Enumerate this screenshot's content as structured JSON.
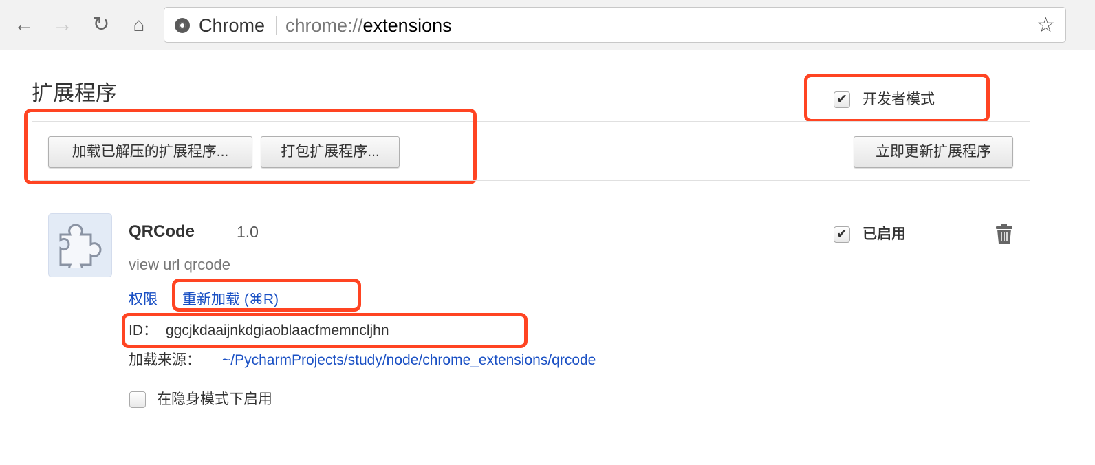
{
  "browser": {
    "site_label": "Chrome",
    "url_prefix": "chrome://",
    "url_path": "extensions"
  },
  "page": {
    "title": "扩展程序",
    "dev_mode": {
      "label": "开发者模式",
      "checked": true
    },
    "buttons": {
      "load_unpacked": "加载已解压的扩展程序...",
      "pack": "打包扩展程序...",
      "update": "立即更新扩展程序"
    }
  },
  "extension": {
    "name": "QRCode",
    "version": "1.0",
    "description": "view url qrcode",
    "permissions_link": "权限",
    "reload_link": "重新加载 (⌘R)",
    "id_label": "ID：",
    "id": "ggcjkdaaijnkdgiaoblaacfmemncljhn",
    "source_label": "加载来源：",
    "source_path": "~/PycharmProjects/study/node/chrome_extensions/qrcode",
    "enabled": {
      "label": "已启用",
      "checked": true
    },
    "incognito": {
      "label": "在隐身模式下启用",
      "checked": false
    }
  },
  "colors": {
    "highlight": "#ff4422",
    "link": "#1a50c4"
  }
}
